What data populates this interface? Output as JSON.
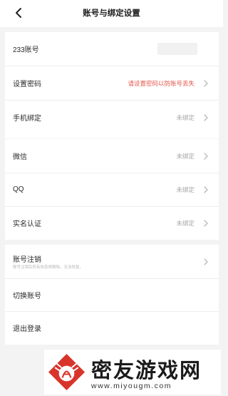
{
  "header": {
    "title": "账号与绑定设置",
    "back_icon": "chevron-left-icon"
  },
  "group1": {
    "rows": [
      {
        "label": "233账号",
        "value": ""
      },
      {
        "label": "设置密码",
        "value": "请设置密码以防账号丢失"
      },
      {
        "label": "手机绑定",
        "value": "未绑定"
      }
    ]
  },
  "group2": {
    "rows": [
      {
        "label": "微信",
        "value": "未绑定"
      },
      {
        "label": "QQ",
        "value": "未绑定"
      },
      {
        "label": "实名认证",
        "value": "未绑定"
      }
    ]
  },
  "group3": {
    "rows": [
      {
        "label": "账号注销",
        "sub": "账号注销后所有信息将删除，无法恢复。"
      },
      {
        "label": "切换账号"
      },
      {
        "label": "退出登录"
      }
    ]
  },
  "watermark": {
    "text": "密友游戏网",
    "url": "www.miyougm.com"
  },
  "colors": {
    "warning": "#e35a4f",
    "muted": "#a6a6a6",
    "background": "#f3f3f3"
  }
}
